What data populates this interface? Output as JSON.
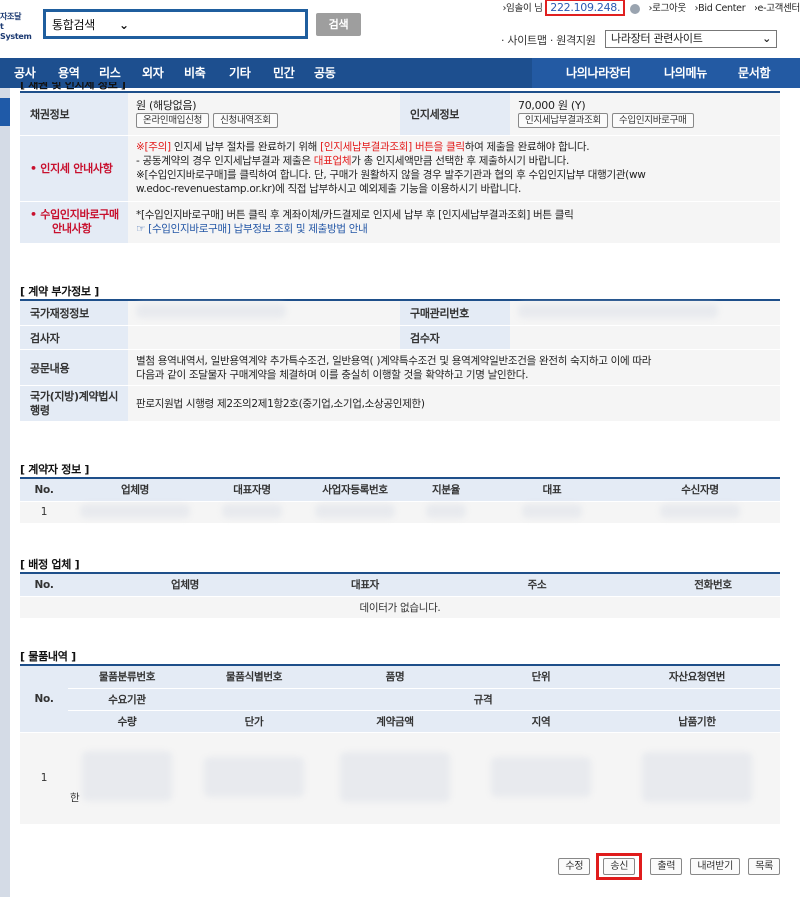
{
  "header": {
    "logo_line1": "자조달",
    "logo_line2": "t System",
    "search_scope": "통합검색",
    "search_button": "검색",
    "user_greeting": "›임솔이 님",
    "ip_address": "222.109.248.",
    "logout": "›로그아웃",
    "bid_center": "›Bid Center",
    "customer_center": "›e-고객센터",
    "sitemap": "· 사이트맵 · 원격지원",
    "related_sites": "나라장터 관련사이트"
  },
  "nav": {
    "items": [
      "공사",
      "용역",
      "리스",
      "외자",
      "비축",
      "기타",
      "민간",
      "공동"
    ],
    "right_items": [
      "나의나라장터",
      "나의메뉴",
      "문서함"
    ]
  },
  "bond_section": {
    "title_partial": "[ 채권 및 인지세 정보 ]",
    "bond_label": "채권정보",
    "bond_value": "원 (해당없음)",
    "bond_btn1": "온라인매입신청",
    "bond_btn2": "신청내역조회",
    "stamp_label": "인지세정보",
    "stamp_value": "70,000 원 (Y)",
    "stamp_btn1": "인지세납부결과조회",
    "stamp_btn2": "수입인지바로구매",
    "guide_label": "인지세 안내사항",
    "guide_line1_a": "※[주의]",
    "guide_line1_b": " 인지세 납부 절차를 완료하기 위해 ",
    "guide_line1_c": "[인지세납부결과조회] 버튼을 클릭",
    "guide_line1_d": "하여 제출을 완료해야 합니다.",
    "guide_line2_a": "  - 공동계약의 경우 인지세납부결과 제출은 ",
    "guide_line2_b": "대표업체",
    "guide_line2_c": "가 총 인지세액만큼 선택한 후 제출하시기 바랍니다.",
    "guide_line3": "※[수입인지바로구매]를 클릭하여 합니다. 단, 구매가 원활하지 않을 경우 발주기관과 협의 후 수입인지납부 대행기관(ww",
    "guide_line4": "w.edoc-revenuestamp.or.kr)에 직접 납부하시고 예외제출 기능을 이용하시기 바랍니다.",
    "buy_label_1": "수입인지바로구매",
    "buy_label_2": "안내사항",
    "buy_line1": "*[수입인지바로구매] 버튼 클릭 후 계좌이체/카드결제로 인지세 납부 후 [인지세납부결과조회] 버튼 클릭",
    "buy_line2": "☞ [수입인지바로구매] 납부정보 조회 및 제출방법 안내"
  },
  "contract_extra": {
    "title": "[ 계약 부가정보 ]",
    "fin_label": "국가재정정보",
    "purchase_label": "구매관리번호",
    "inspector_label": "검사자",
    "receiver_label": "검수자",
    "doc_label": "공문내용",
    "doc_line1": "별첨 용역내역서, 일반용역계약 추가특수조건, 일반용역( )계약특수조건 및 용역계약일반조건을 완전히 숙지하고 이에 따라",
    "doc_line2": "다음과 같이 조달물자 구매계약을 체결하며 이를 충실히 이행할 것을 확약하고 기명 날인한다.",
    "law_label_1": "국가(지방)계약법시",
    "law_label_2": "행령",
    "law_value": "판로지원법 시행령 제2조의2제1항2호(중기업,소기업,소상공인제한)"
  },
  "contractor": {
    "title": "[ 계약자 정보 ]",
    "headers": [
      "No.",
      "업체명",
      "대표자명",
      "사업자등록번호",
      "지분율",
      "대표",
      "수신자명"
    ],
    "row_no": "1"
  },
  "distribution": {
    "title": "[ 배정 업체 ]",
    "headers": [
      "No.",
      "업체명",
      "대표자",
      "주소",
      "전화번호"
    ],
    "empty": "데이터가 없습니다."
  },
  "items": {
    "title": "[ 물품내역 ]",
    "header_row1": [
      "물품분류번호",
      "물품식별번호",
      "품명",
      "단위",
      "자산요청연번"
    ],
    "no_label": "No.",
    "header_row2_a": "수요기관",
    "header_row2_b": "규격",
    "header_row3": [
      "수량",
      "단가",
      "계약금액",
      "지역",
      "납품기한"
    ],
    "row_no": "1",
    "row_partial": "한"
  },
  "actions": {
    "modify": "수정",
    "send": "송신",
    "print": "출력",
    "download": "내려받기",
    "list": "목록"
  }
}
